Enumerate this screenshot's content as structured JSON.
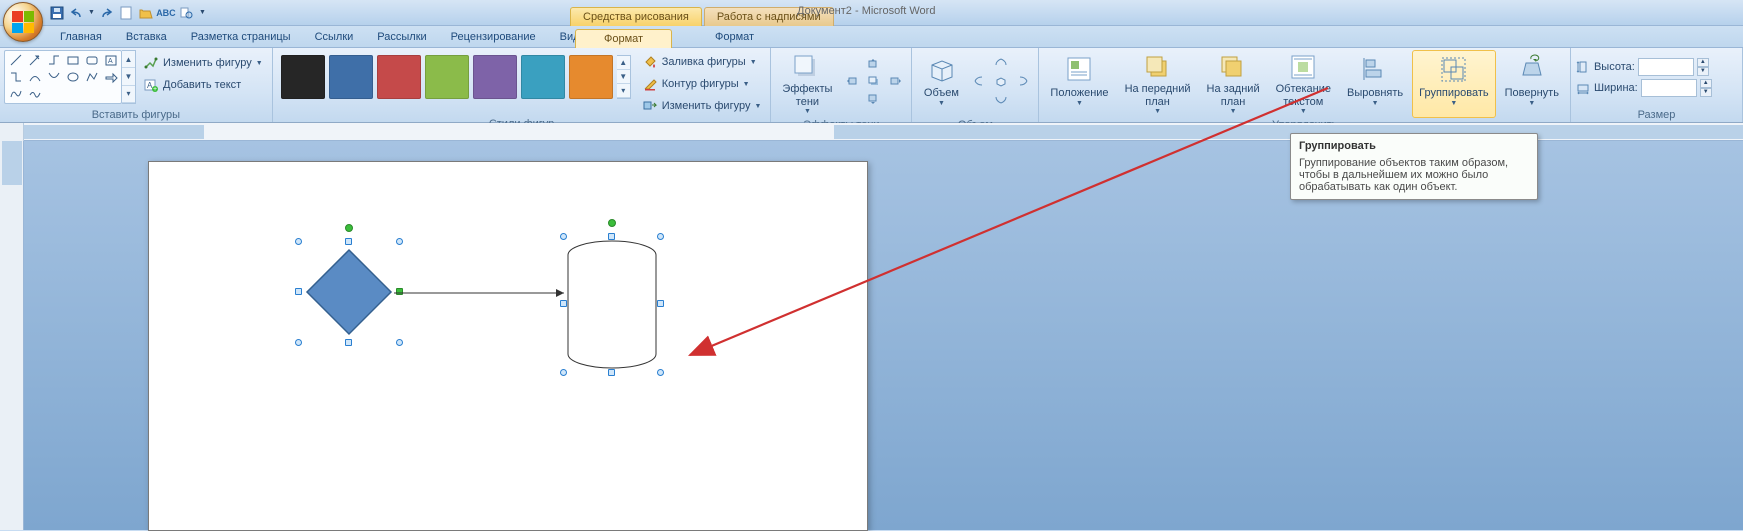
{
  "window": {
    "title": "Документ2 - Microsoft Word"
  },
  "context_tabs": {
    "drawing": "Средства рисования",
    "text": "Работа с надписями"
  },
  "tabs": {
    "home": "Главная",
    "insert": "Вставка",
    "layout": "Разметка страницы",
    "refs": "Ссылки",
    "mail": "Рассылки",
    "review": "Рецензирование",
    "view": "Вид",
    "format1": "Формат",
    "format2": "Формат"
  },
  "ribbon": {
    "insert_shapes": {
      "label": "Вставить фигуры",
      "edit_shape": "Изменить фигуру",
      "add_text": "Добавить текст"
    },
    "shape_styles": {
      "label": "Стили фигур",
      "fill": "Заливка фигуры",
      "outline": "Контур фигуры",
      "change": "Изменить фигуру",
      "colors": [
        "#262626",
        "#3f6fa8",
        "#c54a4a",
        "#8bbb4a",
        "#7e63a8",
        "#3aa0c0",
        "#e68a2e"
      ]
    },
    "shadow": {
      "label": "Эффекты тени",
      "button": "Эффекты\nтени"
    },
    "volume": {
      "label": "Объем",
      "button": "Объем"
    },
    "arrange": {
      "label": "Упорядочить",
      "position": "Положение",
      "front": "На передний\nплан",
      "back": "На задний\nплан",
      "wrap": "Обтекание\nтекстом",
      "align": "Выровнять",
      "group": "Группировать",
      "rotate": "Повернуть"
    },
    "size": {
      "label": "Размер",
      "height": "Высота:",
      "width": "Ширина:",
      "h_val": "",
      "w_val": ""
    }
  },
  "tooltip": {
    "title": "Группировать",
    "body": "Группирование объектов таким образом, чтобы в дальнейшем их можно было обрабатывать как один объект."
  }
}
